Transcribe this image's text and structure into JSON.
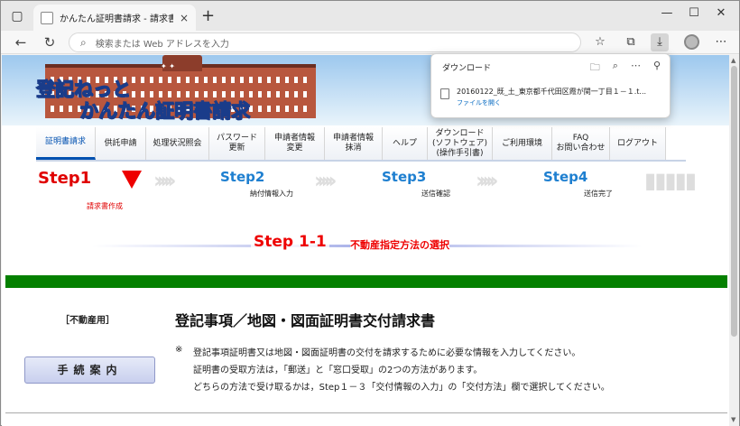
{
  "browser": {
    "tab_title": "かんたん証明書請求 - 請求書作成",
    "tab_close": "×",
    "new_tab": "+",
    "address_placeholder": "検索または Web アドレスを入力",
    "window_controls": {
      "minimize": "—",
      "maximize": "☐",
      "close": "✕"
    }
  },
  "site": {
    "logo_line1": "登記ねっと",
    "logo_line2": "かんたん証明書請求",
    "menu": [
      {
        "label": "証明書請求",
        "active": true
      },
      {
        "label": "供託申請"
      },
      {
        "label": "処理状況照会"
      },
      {
        "label": "パスワード\n更新"
      },
      {
        "label": "申請者情報\n変更"
      },
      {
        "label": "申請者情報\n抹消"
      },
      {
        "label": "ヘルプ"
      },
      {
        "label": "ダウンロード\n(ソフトウェア)\n(操作手引書)"
      },
      {
        "label": "ご利用環境"
      },
      {
        "label": "FAQ\nお問い合わせ"
      },
      {
        "label": "ログアウト"
      }
    ],
    "steps": [
      {
        "label": "Step1",
        "sub": "請求書作成",
        "color": "#e00000"
      },
      {
        "label": "Step2",
        "sub": "納付情報入力",
        "color": "#1e7fd0"
      },
      {
        "label": "Step3",
        "sub": "送信確認",
        "color": "#1e7fd0"
      },
      {
        "label": "Step4",
        "sub": "送信完了",
        "color": "#1e7fd0"
      }
    ],
    "substep_label": "Step 1-1",
    "substep_title": "不動産指定方法の選択",
    "category": "［不動産用］",
    "heading": "登記事項／地図・図面証明書交付請求書",
    "guide_button": "手続案内",
    "note_mark": "※",
    "notes": [
      "登記事項証明書又は地図・図面証明書の交付を請求するために必要な情報を入力してください。",
      "証明書の受取方法は，「郵送」と「窓口受取」の2つの方法があります。",
      "どちらの方法で受け取るかは，Step１－３「交付情報の入力」の「交付方法」欄で選択してください。"
    ]
  },
  "download_panel": {
    "title": "ダウンロード",
    "file_name": "20160122_既_土_東京都千代田区霞が関一丁目１－１.t...",
    "open_link": "ファイルを開く"
  }
}
